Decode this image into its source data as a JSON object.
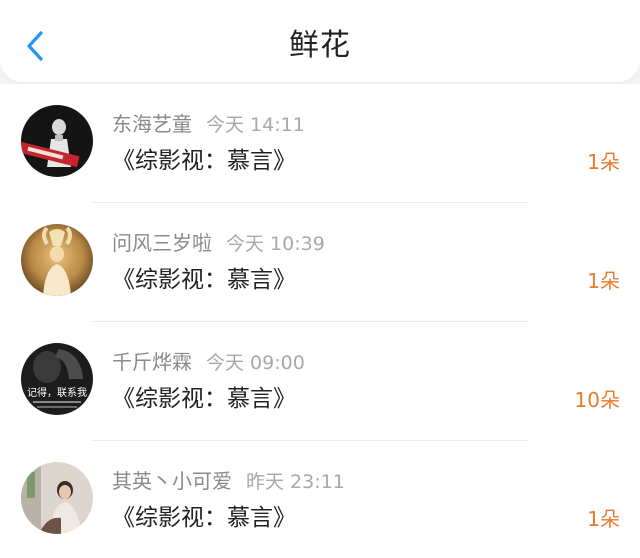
{
  "header": {
    "title": "鲜花",
    "back_icon": "chevron-left-icon",
    "accent_color": "#1a9af5"
  },
  "list": {
    "items": [
      {
        "user": "东海艺童",
        "time": "今天 14:11",
        "book": "《综影视：慕言》",
        "count": "1朵"
      },
      {
        "user": "问风三岁啦",
        "time": "今天 10:39",
        "book": "《综影视：慕言》",
        "count": "1朵"
      },
      {
        "user": "千斤烨霖",
        "time": "今天 09:00",
        "book": "《综影视：慕言》",
        "count": "10朵"
      },
      {
        "user": "其英丶小可爱",
        "time": "昨天 23:11",
        "book": "《综影视：慕言》",
        "count": "1朵"
      }
    ],
    "count_color": "#ec7a2c",
    "avatar2_text": "记得，联系我"
  }
}
